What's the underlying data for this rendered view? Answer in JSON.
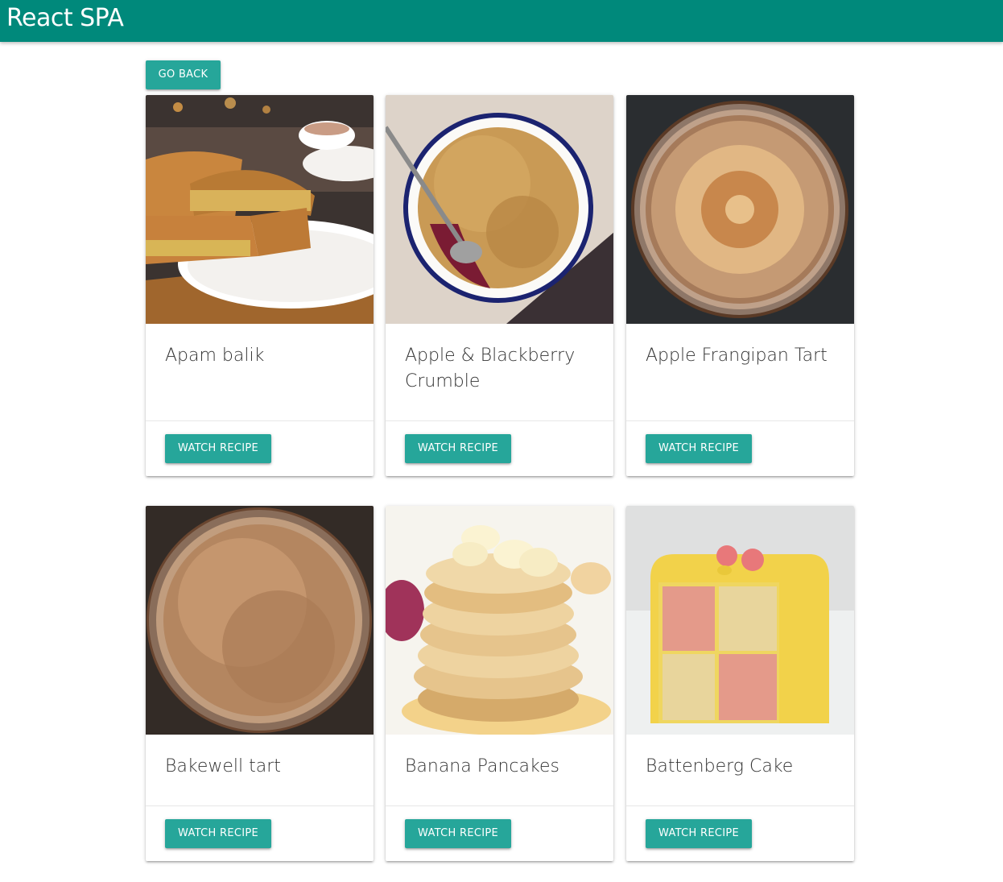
{
  "app": {
    "title": "React SPA",
    "accent": "#00897b",
    "button_color": "#26a69a"
  },
  "nav": {
    "back_label": "Go Back"
  },
  "recipes": [
    {
      "title": "Apam balik",
      "action": "Watch Recipe"
    },
    {
      "title": "Apple & Blackberry Crumble",
      "action": "Watch Recipe"
    },
    {
      "title": "Apple Frangipan Tart",
      "action": "Watch Recipe"
    },
    {
      "title": "Bakewell tart",
      "action": "Watch Recipe"
    },
    {
      "title": "Banana Pancakes",
      "action": "Watch Recipe"
    },
    {
      "title": "Battenberg Cake",
      "action": "Watch Recipe"
    }
  ]
}
